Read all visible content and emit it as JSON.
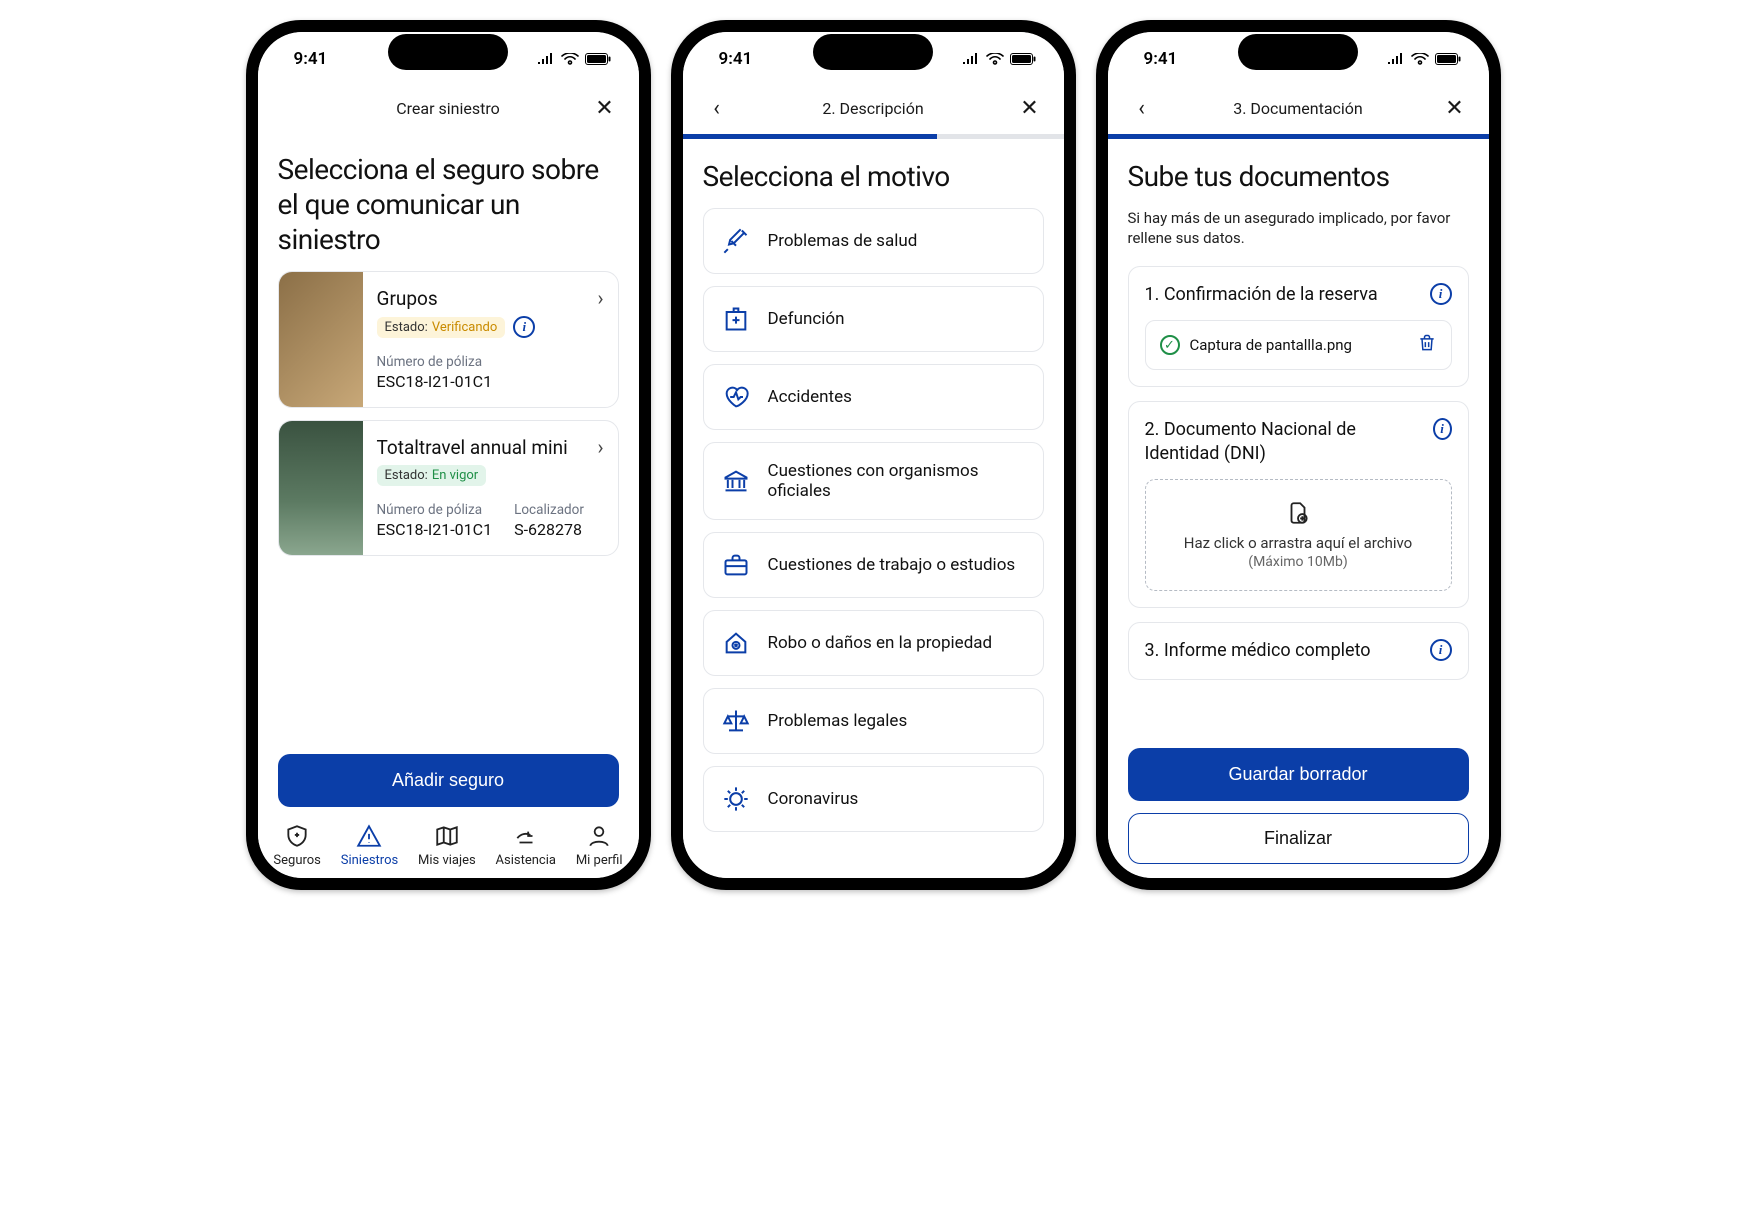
{
  "status_time": "9:41",
  "screen1": {
    "header_title": "Crear siniestro",
    "title": "Selecciona el seguro sobre el que comunicar un siniestro",
    "policies": [
      {
        "name": "Grupos",
        "status_label": "Estado:",
        "status_value": "Verificando",
        "status_kind": "verifying",
        "policy_no_label": "Número de póliza",
        "policy_no": "ESC18-I21-01C1",
        "show_info": true
      },
      {
        "name": "Totaltravel annual mini",
        "status_label": "Estado:",
        "status_value": "En vigor",
        "status_kind": "envigor",
        "policy_no_label": "Número de póliza",
        "policy_no": "ESC18-I21-01C1",
        "locator_label": "Localizador",
        "locator": "S-628278"
      }
    ],
    "add_button": "Añadir seguro",
    "tabs": [
      "Seguros",
      "Siniestros",
      "Mis viajes",
      "Asistencia",
      "Mi perfil"
    ]
  },
  "screen2": {
    "step_label": "2. Descripción",
    "title": "Selecciona el motivo",
    "motives": [
      {
        "icon": "syringe-icon",
        "label": "Problemas de salud"
      },
      {
        "icon": "hospital-icon",
        "label": "Defunción"
      },
      {
        "icon": "heart-icon",
        "label": "Accidentes"
      },
      {
        "icon": "bank-icon",
        "label": "Cuestiones con organismos oficiales"
      },
      {
        "icon": "briefcase-icon",
        "label": "Cuestiones de trabajo o estudios"
      },
      {
        "icon": "house-x-icon",
        "label": "Robo o daños en la propiedad"
      },
      {
        "icon": "scales-icon",
        "label": "Problemas legales"
      },
      {
        "icon": "virus-icon",
        "label": "Coronavirus"
      }
    ]
  },
  "screen3": {
    "step_label": "3. Documentación",
    "title": "Sube tus documentos",
    "subtitle": "Si hay más de un asegurado implicado, por favor rellene sus datos.",
    "docs": {
      "confirmation": {
        "title": "1. Confirmación de la reserva",
        "file": "Captura de pantallla.png"
      },
      "dni": {
        "title": "2. Documento Nacional de Identidad (DNI)",
        "drop_hint": "Haz click o arrastra aquí el archivo",
        "drop_max": "(Máximo 10Mb)"
      },
      "medical": {
        "title": "3. Informe médico completo"
      }
    },
    "save_draft": "Guardar borrador",
    "finish": "Finalizar"
  }
}
